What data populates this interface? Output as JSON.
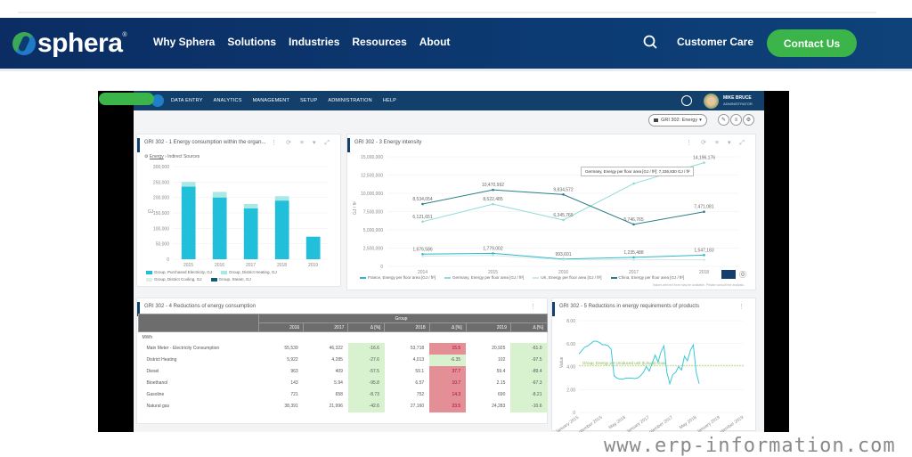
{
  "site": {
    "logo_text": "sphera",
    "logo_reg": "®",
    "menu": [
      "Why Sphera",
      "Solutions",
      "Industries",
      "Resources",
      "About"
    ],
    "search_icon": "search-icon",
    "customer_care": "Customer Care",
    "contact_us": "Contact Us",
    "brand_color": "#0c3a72",
    "accent_green": "#3bb44a"
  },
  "app": {
    "menu": [
      "DATA ENTRY",
      "ANALYTICS",
      "MANAGEMENT",
      "SETUP",
      "ADMINISTRATION",
      "HELP"
    ],
    "user_name": "MIKE BRUCE",
    "user_role": "ADMINISTRATOR",
    "dashboard_select": "GRI 302: Energy",
    "toolbar_icons": [
      "edit-icon",
      "list-icon",
      "gear-icon"
    ]
  },
  "panels": {
    "p1": {
      "title": "GRI 302 - 1 Energy consumption within the organ...",
      "crumb_root": "Energy",
      "crumb_child": "Indirect Sources",
      "ylabel": "GJ"
    },
    "p2": {
      "title": "GRI 302 - 3 Energy intensity",
      "ylabel": "GJ / ft²",
      "tooltip": "Germany, Energy per floor area [GJ / ft²]: 7,336,830 GJ / ft²",
      "footnote": "Values derived from may be available. Please consult the analysis."
    },
    "p3": {
      "title": "GRI 302 - 4 Reductions of energy consumption"
    },
    "p4": {
      "title": "GRI 302 - 5 Reductions in energy requirements of products",
      "ylabel": "Value",
      "goal_label": "Group, Energy per produced unit (kJ/unit) Goal"
    }
  },
  "chart_data": [
    {
      "type": "bar",
      "title": "GRI 302 - 1 Energy consumption within the organ...",
      "categories": [
        "2015",
        "2016",
        "2017",
        "2018",
        "2019"
      ],
      "series": [
        {
          "name": "Group, Purchased Electricity, GJ",
          "color": "#21bfd9",
          "values": [
            235000,
            200000,
            165000,
            190000,
            73000
          ]
        },
        {
          "name": "Group, District Heating, GJ",
          "color": "#a9e8e4",
          "values": [
            15000,
            18000,
            14000,
            14000,
            0
          ]
        },
        {
          "name": "Group, District Cooling, GJ",
          "color": "#dcefe6",
          "values": [
            0,
            0,
            0,
            0,
            0
          ]
        },
        {
          "name": "Group, Steam, GJ",
          "color": "#0f5c74",
          "values": [
            0,
            0,
            0,
            0,
            0
          ]
        }
      ],
      "yticks": [
        "0",
        "50,000",
        "100,000",
        "150,000",
        "200,000",
        "250,000",
        "300,000"
      ],
      "ylim": [
        0,
        300000
      ],
      "ylabel": "GJ",
      "stacked": true
    },
    {
      "type": "line",
      "title": "GRI 302 - 3 Energy intensity",
      "categories": [
        "2014",
        "2015",
        "2016",
        "2017",
        "2018"
      ],
      "yticks": [
        "0",
        "2,500,000",
        "5,000,000",
        "7,500,000",
        "10,000,000",
        "12,500,000",
        "15,000,000"
      ],
      "ylim": [
        0,
        15000000
      ],
      "ylabel": "GJ / ft²",
      "series": [
        {
          "name": "France, Energy per floor area [GJ / ft²]",
          "color": "#33b6c9",
          "values": [
            1676586,
            1779002,
            993601,
            1235488,
            1547183
          ],
          "labels": [
            "1,676,586",
            "1,779,002",
            "993,601",
            "1,235,488",
            "1,547,183"
          ]
        },
        {
          "name": "Germany, Energy per floor area [GJ / ft²]",
          "color": "#8fdcd6",
          "values": [
            6121651,
            8522485,
            6345765,
            11336830,
            14196176
          ],
          "labels": [
            "6,121,651",
            "8,522,485",
            "6,345,765",
            "",
            "14,196,176"
          ]
        },
        {
          "name": "UK, Energy per floor area [GJ / ft²]",
          "color": "#cfe9e6",
          "values": [
            1400000,
            1500000,
            900000,
            900000,
            900000
          ],
          "labels": [
            "",
            "",
            "",
            "",
            ""
          ]
        },
        {
          "name": "China, Energy per floor area [GJ / ft²]",
          "color": "#2a7f86",
          "values": [
            8534054,
            10470992,
            9834572,
            5746765,
            7471081
          ],
          "labels": [
            "8,534,054",
            "10,470,992",
            "9,834,572",
            "5,746,765",
            "7,471,081"
          ]
        }
      ],
      "legend": "bottom"
    },
    {
      "type": "table",
      "title": "GRI 302 - 4 Reductions of energy consumption",
      "group_header": "Group",
      "columns": [
        "2016",
        "2017",
        "Δ [%]",
        "2018",
        "Δ [%]",
        "2019",
        "Δ [%]"
      ],
      "unit_row": "MWh",
      "rows": [
        {
          "label": "Main Meter - Electricity Consumption",
          "values": [
            "55,539",
            "46,322",
            "-16.6",
            "53,718",
            "15.5",
            "20,925",
            "-61.0"
          ],
          "flags": [
            "",
            "",
            "g",
            "",
            "r",
            "",
            "g"
          ]
        },
        {
          "label": "District Heating",
          "values": [
            "5,922",
            "4,285",
            "-27.6",
            "4,013",
            "-6.35",
            "102",
            "-97.5"
          ],
          "flags": [
            "",
            "",
            "g",
            "",
            "g",
            "",
            "g"
          ]
        },
        {
          "label": "Diesel",
          "values": [
            "963",
            "409",
            "-57.5",
            "59.1",
            "37.7",
            "59.4",
            "-89.4"
          ],
          "flags": [
            "",
            "",
            "g",
            "",
            "r",
            "",
            "g"
          ]
        },
        {
          "label": "Bioethanol",
          "values": [
            "143",
            "5.94",
            "-95.8",
            "6.57",
            "10.7",
            "2.15",
            "-67.3"
          ],
          "flags": [
            "",
            "",
            "g",
            "",
            "r",
            "",
            "g"
          ]
        },
        {
          "label": "Gasoline",
          "values": [
            "721",
            "658",
            "-8.73",
            "752",
            "14.3",
            "690",
            "-8.21"
          ],
          "flags": [
            "",
            "",
            "g",
            "",
            "r",
            "",
            "g"
          ]
        },
        {
          "label": "Natural gas",
          "values": [
            "38,391",
            "21,996",
            "-42.6",
            "27,160",
            "23.5",
            "24,283",
            "-10.6"
          ],
          "flags": [
            "",
            "",
            "g",
            "",
            "r",
            "",
            "g"
          ]
        }
      ]
    },
    {
      "type": "line",
      "title": "GRI 302 - 5 Reductions in energy requirements of products",
      "ylabel": "Value",
      "yticks": [
        "0",
        "2.00",
        "4.00",
        "6.00",
        "8.00"
      ],
      "ylim": [
        0,
        8
      ],
      "xticks": [
        "January 2015",
        "September 2015",
        "May 2016",
        "January 2017",
        "September 2017",
        "May 2018",
        "January 2019",
        "September 2019"
      ],
      "goal": 4.1,
      "series": [
        {
          "name": "Group, Energy per produced unit",
          "color": "#3cc6d6",
          "values": [
            5.1,
            5.4,
            5.7,
            5.8,
            6.0,
            6.2,
            6.2,
            6.1,
            5.9,
            5.9,
            5.8,
            5.5,
            3.2,
            3.0,
            2.9,
            2.9,
            3.0,
            3.0,
            3.0,
            2.95,
            3.0,
            3.2,
            3.5,
            4.0,
            3.6,
            4.3,
            5.0,
            4.4,
            5.3,
            5.8,
            3.5,
            2.5,
            3.3,
            3.5,
            4.0,
            3.7,
            4.9,
            4.5,
            5.4,
            5.9,
            3.5,
            2.5
          ]
        }
      ]
    }
  ],
  "watermark": "www.erp-information.com"
}
